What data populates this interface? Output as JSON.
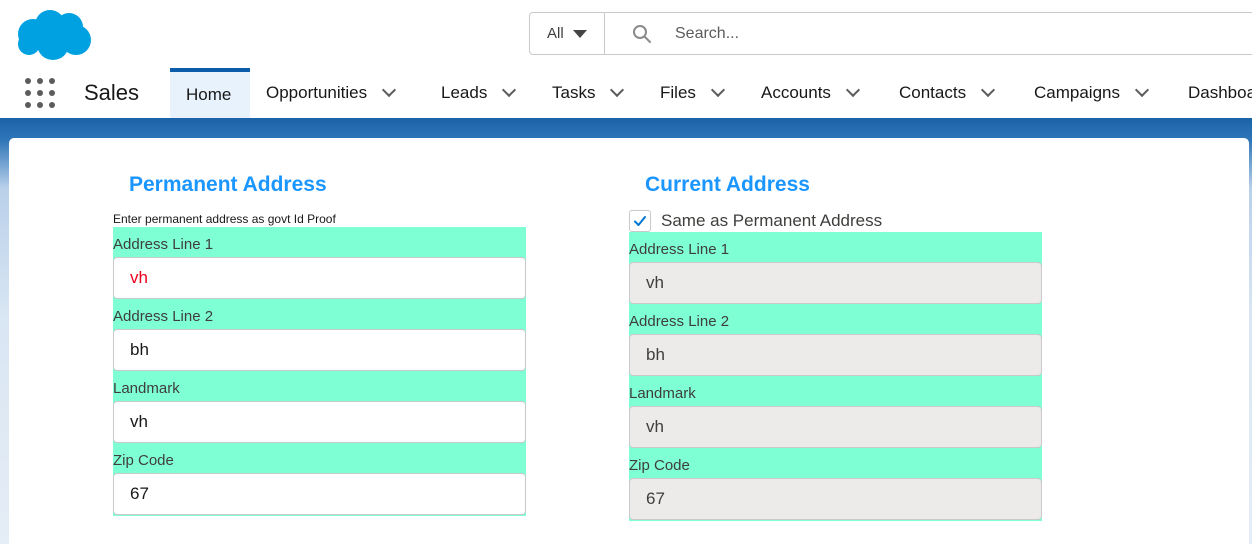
{
  "header": {
    "search_scope": "All",
    "search_placeholder": "Search..."
  },
  "nav": {
    "app_name": "Sales",
    "tabs": [
      {
        "label": "Home",
        "active": true,
        "has_menu": false
      },
      {
        "label": "Opportunities",
        "has_menu": true
      },
      {
        "label": "Leads",
        "has_menu": true
      },
      {
        "label": "Tasks",
        "has_menu": true
      },
      {
        "label": "Files",
        "has_menu": true
      },
      {
        "label": "Accounts",
        "has_menu": true
      },
      {
        "label": "Contacts",
        "has_menu": true
      },
      {
        "label": "Campaigns",
        "has_menu": true
      },
      {
        "label": "Dashboa",
        "has_menu": false
      }
    ]
  },
  "permanent": {
    "title": "Permanent Address",
    "hint": "Enter permanent address as govt Id Proof",
    "fields": [
      {
        "label": "Address Line 1",
        "value": "vh"
      },
      {
        "label": "Address Line 2",
        "value": "bh"
      },
      {
        "label": "Landmark",
        "value": "vh"
      },
      {
        "label": "Zip Code",
        "value": "67"
      }
    ]
  },
  "current": {
    "title": "Current Address",
    "same_as_label": "Same as Permanent Address",
    "same_as_checked": true,
    "fields": [
      {
        "label": "Address Line 1",
        "value": "vh"
      },
      {
        "label": "Address Line 2",
        "value": "bh"
      },
      {
        "label": "Landmark",
        "value": "vh"
      },
      {
        "label": "Zip Code",
        "value": "67"
      }
    ]
  },
  "colors": {
    "brand_blue": "#0b5cab",
    "title_blue": "#1b96ff",
    "form_background": "#7fffd4",
    "error_text": "#ea001e"
  },
  "icons": [
    "salesforce-cloud-logo",
    "search-icon",
    "app-launcher-icon",
    "chevron-down-icon",
    "checkmark-icon"
  ]
}
